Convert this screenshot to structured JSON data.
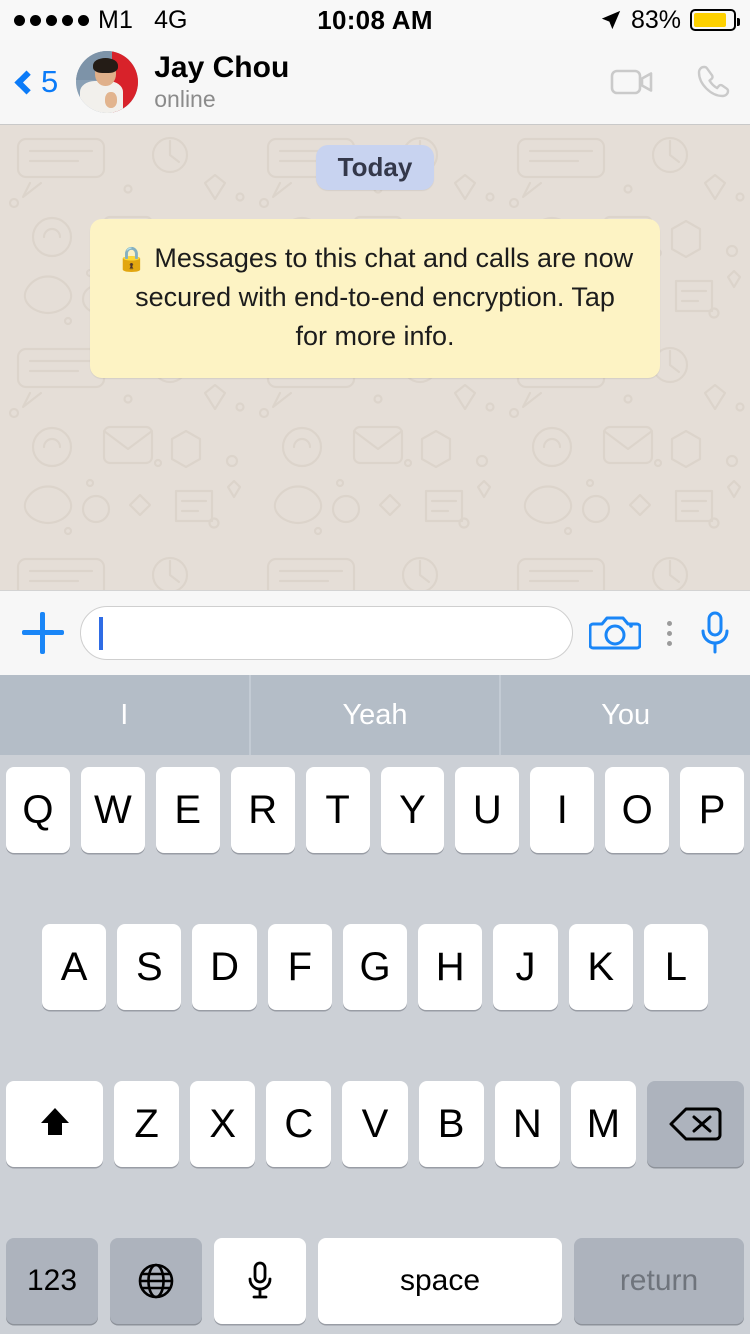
{
  "status_bar": {
    "signal_dots": 5,
    "carrier": "M1",
    "network": "4G",
    "time": "10:08 AM",
    "battery_percent": "83%",
    "battery_level": 83,
    "battery_color": "#fdd000",
    "location_icon": "location-arrow-icon"
  },
  "header": {
    "back_count": "5",
    "back_icon": "chevron-left-icon",
    "contact_name": "Jay Chou",
    "contact_status": "online",
    "video_call_icon": "video-camera-icon",
    "voice_call_icon": "phone-icon",
    "avatar_icon": "contact-avatar"
  },
  "chat": {
    "day_divider": "Today",
    "encryption_notice": "Messages to this chat and calls are now secured with end-to-end encryption. Tap for more info.",
    "lock_icon": "🔒",
    "wallpaper": "whatsapp-doodle-pattern",
    "background_color": "#e5ded7",
    "day_badge_color": "#c8d3f0",
    "notice_color": "#fdf3c4"
  },
  "input_bar": {
    "attach_icon": "plus-icon",
    "message_value": "",
    "message_placeholder": "",
    "camera_icon": "camera-icon",
    "more_icon": "more-vertical-icon",
    "mic_icon": "microphone-icon",
    "accent_color": "#1a86f7"
  },
  "suggestions": [
    "I",
    "Yeah",
    "You"
  ],
  "keyboard": {
    "row1": [
      "Q",
      "W",
      "E",
      "R",
      "T",
      "Y",
      "U",
      "I",
      "O",
      "P"
    ],
    "row2": [
      "A",
      "S",
      "D",
      "F",
      "G",
      "H",
      "J",
      "K",
      "L"
    ],
    "row3": [
      "Z",
      "X",
      "C",
      "V",
      "B",
      "N",
      "M"
    ],
    "shift_icon": "shift-arrow-icon",
    "backspace_icon": "backspace-delete-icon",
    "numbers_label": "123",
    "globe_icon": "globe-language-icon",
    "dictation_icon": "microphone-icon",
    "space_label": "space",
    "return_label": "return",
    "background_color": "#ccd0d6",
    "key_color": "#ffffff",
    "special_key_color": "#adb3bd"
  }
}
